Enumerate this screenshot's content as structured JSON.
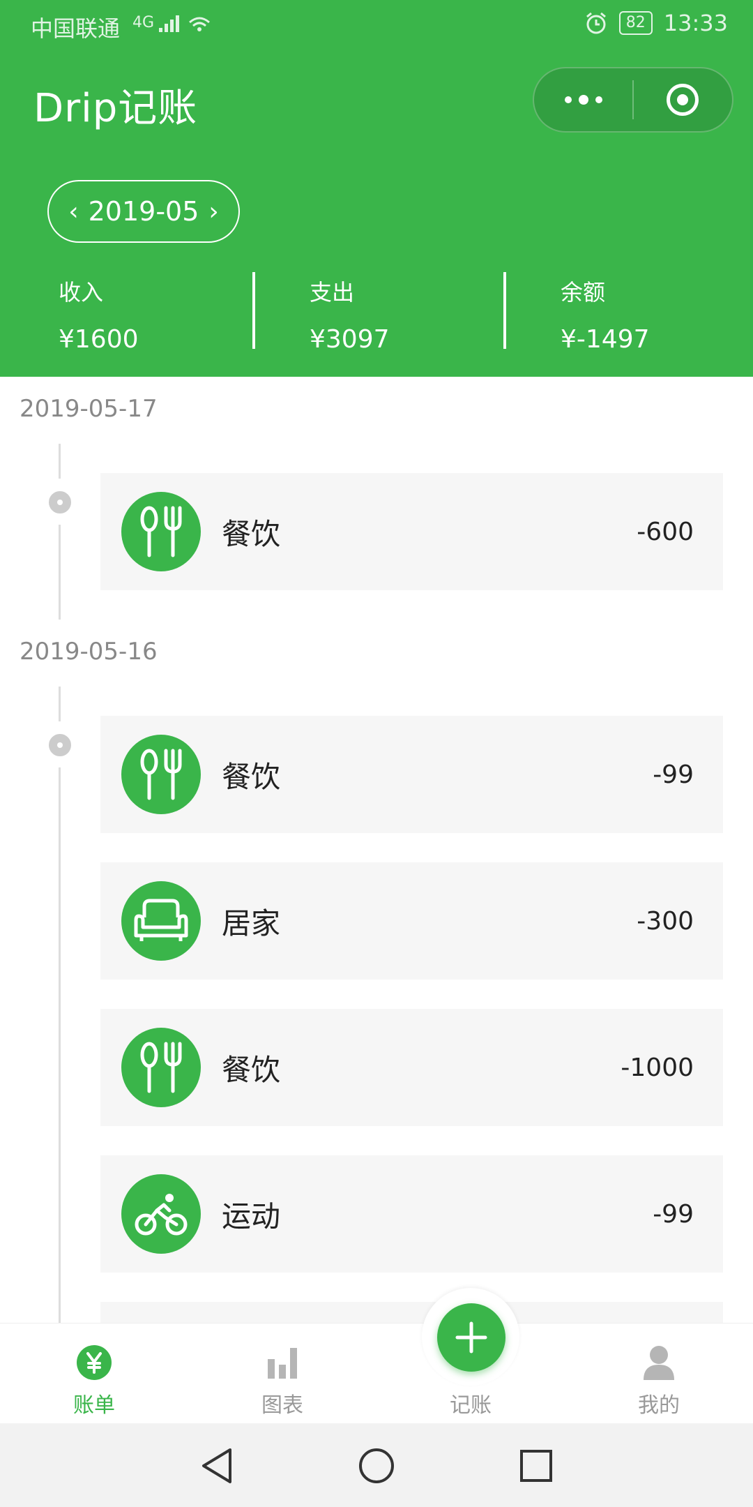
{
  "status_bar": {
    "carrier": "中国联通",
    "network": "4G",
    "battery": "82",
    "time": "13:33"
  },
  "header": {
    "app_title": "Drip记账",
    "month": "2019-05",
    "summary": [
      {
        "label": "收入",
        "value": "¥1600"
      },
      {
        "label": "支出",
        "value": "¥3097"
      },
      {
        "label": "余额",
        "value": "¥-1497"
      }
    ]
  },
  "days": [
    {
      "date": "2019-05-17",
      "entries": [
        {
          "category": "餐饮",
          "icon": "utensils-icon",
          "amount": "-600"
        }
      ]
    },
    {
      "date": "2019-05-16",
      "entries": [
        {
          "category": "餐饮",
          "icon": "utensils-icon",
          "amount": "-99"
        },
        {
          "category": "居家",
          "icon": "sofa-icon",
          "amount": "-300"
        },
        {
          "category": "餐饮",
          "icon": "utensils-icon",
          "amount": "-1000"
        },
        {
          "category": "运动",
          "icon": "cyclist-icon",
          "amount": "-99"
        }
      ]
    }
  ],
  "tabbar": {
    "items": [
      {
        "label": "账单",
        "icon": "yuan-icon",
        "active": true
      },
      {
        "label": "图表",
        "icon": "bar-chart-icon",
        "active": false
      },
      {
        "label": "记账",
        "icon": "plus-icon",
        "active": false
      },
      {
        "label": "我的",
        "icon": "person-icon",
        "active": false
      }
    ]
  },
  "colors": {
    "brand_green": "#3ab54a",
    "card_bg": "#f6f6f6",
    "muted_text": "#888888"
  }
}
